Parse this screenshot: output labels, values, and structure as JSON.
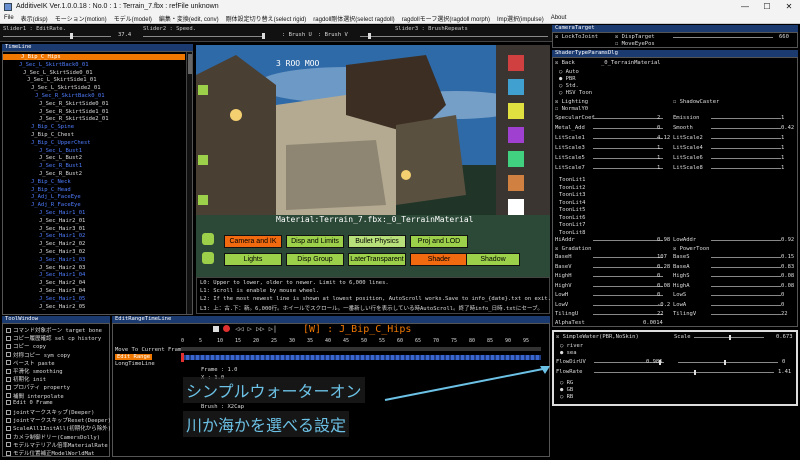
{
  "window": {
    "title": "AdditiveIK Ver.1.0.0.18 : No.0 : 1 : Terrain_7.fbx : refFile unknown",
    "controls": [
      "—",
      "☐",
      "✕"
    ]
  },
  "menu": [
    "File",
    "表示(disp)",
    "モーション(motion)",
    "モデル(model)",
    "編集・変換(edit, conv)",
    "剛体設定切り替え(select rigid)",
    "ragdoll剛体選択(select ragdoll)",
    "ragdollモーフ選択(ragdoll morph)",
    "Imp選択(impulse)",
    "About"
  ],
  "sliders": {
    "s1_label": "Slider1 : EditRate.",
    "s1_value": "37.4",
    "s2_label": "Slider2 : Speed.",
    "brush_u": ": Brush U",
    "brush_v": ": Brush V",
    "s3_label": "Slider3 : BrushRepeats"
  },
  "timeline": {
    "title": "TimeLine",
    "items": [
      {
        "label": "J_Bip_C_Hips",
        "color": "sel"
      },
      {
        "label": "J_Sec_L_SkirtBack0_01",
        "color": "blue"
      },
      {
        "label": "J_Sec_L_SkirtSide0_01",
        "color": "white"
      },
      {
        "label": "J_Sec_L_SkirtSide1_01",
        "color": "white"
      },
      {
        "label": "J_Sec_L_SkirtSide2_01",
        "color": "white"
      },
      {
        "label": "J_Sec_R_SkirtBack0_01",
        "color": "blue"
      },
      {
        "label": "J_Sec_R_SkirtSide0_01",
        "color": "white"
      },
      {
        "label": "J_Sec_R_SkirtSide1_01",
        "color": "white"
      },
      {
        "label": "J_Sec_R_SkirtSide2_01",
        "color": "white"
      },
      {
        "label": "J_Bip_C_Spine",
        "color": "blue"
      },
      {
        "label": "J_Bip_C_Chest",
        "color": "white"
      },
      {
        "label": "J_Bip_C_UpperChest",
        "color": "blue"
      },
      {
        "label": "J_Sec_L_Bust1",
        "color": "blue"
      },
      {
        "label": "J_Sec_L_Bust2",
        "color": "white"
      },
      {
        "label": "J_Sec_R_Bust1",
        "color": "blue"
      },
      {
        "label": "J_Sec_R_Bust2",
        "color": "white"
      },
      {
        "label": "J_Bip_C_Neck",
        "color": "blue"
      },
      {
        "label": "J_Bip_C_Head",
        "color": "blue"
      },
      {
        "label": "J_Adj_L_FaceEye",
        "color": "blue"
      },
      {
        "label": "J_Adj_R_FaceEye",
        "color": "blue"
      },
      {
        "label": "J_Sec_Hair1_01",
        "color": "blue"
      },
      {
        "label": "J_Sec_Hair2_01",
        "color": "white"
      },
      {
        "label": "J_Sec_Hair3_01",
        "color": "white"
      },
      {
        "label": "J_Sec_Hair1_02",
        "color": "blue"
      },
      {
        "label": "J_Sec_Hair2_02",
        "color": "white"
      },
      {
        "label": "J_Sec_Hair3_02",
        "color": "white"
      },
      {
        "label": "J_Sec_Hair1_03",
        "color": "blue"
      },
      {
        "label": "J_Sec_Hair2_03",
        "color": "white"
      },
      {
        "label": "J_Sec_Hair1_04",
        "color": "blue"
      },
      {
        "label": "J_Sec_Hair2_04",
        "color": "white"
      },
      {
        "label": "J_Sec_Hair3_04",
        "color": "white"
      },
      {
        "label": "J_Sec_Hair1_05",
        "color": "blue"
      },
      {
        "label": "J_Sec_Hair2_05",
        "color": "white"
      }
    ]
  },
  "viewport": {
    "material_label": "Material:Terrain_7.fbx:_0_TerrainMaterial",
    "hud_text": "3 ROO MOO",
    "buttons_row1": [
      {
        "label": "Camera and IK",
        "style": "orange"
      },
      {
        "label": "Disp and Limits",
        "style": "green"
      },
      {
        "label": "Bullet Physics",
        "style": "light"
      },
      {
        "label": "Proj and LOD",
        "style": "green"
      }
    ],
    "buttons_row2": [
      {
        "label": "Lights",
        "style": "green"
      },
      {
        "label": "Disp Group",
        "style": "green"
      },
      {
        "label": "LaterTransparent",
        "style": "green"
      },
      {
        "label": "Shader",
        "style": "orange"
      },
      {
        "label": "Shadow",
        "style": "green"
      }
    ]
  },
  "log": [
    "L0: Upper to lower, older to newer. Limit to 6,000 lines.",
    "L1: Scroll is enable by mouse wheel.",
    "L2: If the most newest line is shown at lowest position, AutoScroll works.Save to info_{date}.txt on exit.",
    "L3: 上：古.下：新。6,000行。ホイールでスクロール。一番新しい行を表示している時AutoScroll。終了時info_日時.txtにセーブ。"
  ],
  "camera_target": {
    "title": "CameraTarget",
    "lock_label": "LockToJoint",
    "disp_target": "DispTarget",
    "move_eye_pos": "MoveEyePos",
    "value": "660"
  },
  "shader_params": {
    "title": "ShaderTypeParamsDlg",
    "material": "_0_TerrainMaterial",
    "back_label": "Back",
    "shader_options": [
      "Auto",
      "PBR",
      "Std.",
      "HSV Toon"
    ],
    "lighting": "Lighting",
    "shadow_caster": "ShadowCaster",
    "normal_y": "NormalY0",
    "rows": [
      {
        "left": "SpecularCoef",
        "lval": "2",
        "right": "Emission",
        "rval": "1"
      },
      {
        "left": "Metal_Add",
        "lval": "0",
        "right": "Smooth",
        "rval": "0.42"
      },
      {
        "left": "LitScale1",
        "lval": "4.12",
        "right": "LitScale2",
        "rval": "1"
      },
      {
        "left": "LitScale3",
        "lval": "1",
        "right": "LitScale4",
        "rval": "1"
      },
      {
        "left": "LitScale5",
        "lval": "1",
        "right": "LitScale6",
        "rval": "1"
      },
      {
        "left": "LitScale7",
        "lval": "1",
        "right": "LitScale8",
        "rval": "1"
      }
    ],
    "toon_title": "ToonLit1",
    "toon_items": [
      "ToonLit1",
      "ToonLit2",
      "ToonLit3",
      "ToonLit4",
      "ToonLit5",
      "ToonLit6",
      "ToonLit7",
      "ToonLit8"
    ],
    "hi_row": {
      "left": "HiAddr",
      "lval": "0.98",
      "right": "LowAddr",
      "rval": "0.92"
    },
    "gradation": "Gradation",
    "power_toon": "PowerToon",
    "grad_rows": [
      {
        "left": "BaseH",
        "lval": "107",
        "right": "BaseS",
        "rval": "0.15"
      },
      {
        "left": "BaseV",
        "lval": "0.28",
        "right": "BaseA",
        "rval": "0.83"
      },
      {
        "left": "HighH",
        "lval": "0",
        "right": "HighS",
        "rval": "0.08"
      },
      {
        "left": "HighV",
        "lval": "0.08",
        "right": "HighA",
        "rval": "0.08"
      },
      {
        "left": "LowH",
        "lval": "0",
        "right": "LowS",
        "rval": "0"
      },
      {
        "left": "LowV",
        "lval": "-0.2",
        "right": "LowA",
        "rval": "0"
      },
      {
        "left": "TilingU",
        "lval": "22",
        "right": "TilingV",
        "rval": "22"
      }
    ],
    "alpha_test": "AlphaTest",
    "alpha_val": "0.0014"
  },
  "water": {
    "title": "SimpleWater(PBR,NoSkin)",
    "scale_label": "Scale",
    "scale_value": "0.673",
    "options": [
      "river",
      "sea"
    ],
    "flow_dir_label": "FlowDirUV",
    "flow_dir_value": "0.985",
    "flow_dir_value2": "0",
    "flow_rate_label": "FlowRate",
    "flow_rate_value": "1.41",
    "channels": [
      "RG",
      "GB",
      "RB"
    ]
  },
  "tool_window": {
    "title": "ToolWindow",
    "items": [
      "コマンド対象ボーン target bone",
      "コピー履歴確認 sel cp history",
      "コピー copy",
      "対称コピー sym copy",
      "ペースト paste",
      "平滑化 smoothing",
      "初期化 init",
      "プロパティ property",
      "補間 interpolate",
      "Edit 0 Frame",
      "jointマークスキップ(Deeper)",
      "jointマークスキップReset(Deeper)",
      "ScaleAll1InitAll(初期化から除外)",
      "カメラ制御ドリー(CamersDolly)",
      "モデルマテリアル倍率MaterialRate",
      "モデル位置補正ModelWorldMat"
    ]
  },
  "edit_range": {
    "title": "EditRangeTimeLine",
    "current_joint": "[W] : J_Bip_C_Hips",
    "move_label": "Move To Current Frame",
    "edit_label": "Edit Range",
    "long_label": "LongTimeLine",
    "frame_text": "Frame : 1.0",
    "x_text": "X : 1.0",
    "brush_text": "Brush : X2Cap",
    "ticks": [
      "0",
      "5",
      "10",
      "15",
      "20",
      "25",
      "30",
      "35",
      "40",
      "45",
      "50",
      "55",
      "60",
      "65",
      "70",
      "75",
      "80",
      "85",
      "90",
      "95"
    ]
  },
  "annotations": {
    "line1": "シンプルウォーターオン",
    "line2": "川か海かを選べる設定"
  }
}
